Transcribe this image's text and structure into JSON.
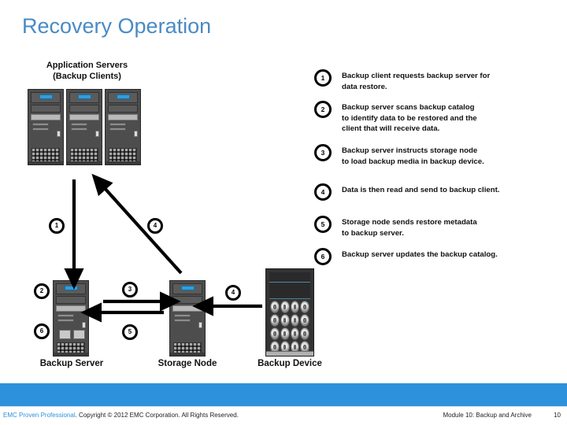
{
  "slide": {
    "title": "Recovery Operation",
    "title_color": "#4a8ac4",
    "accent_color": "#2e91dc",
    "background": "#ffffff"
  },
  "diagram": {
    "group_heading_line1": "Application Servers",
    "group_heading_line2": "(Backup Clients)",
    "components": [
      {
        "name": "backup-server",
        "label": "Backup Server"
      },
      {
        "name": "storage-node",
        "label": "Storage Node"
      },
      {
        "name": "backup-device",
        "label": "Backup Device"
      }
    ],
    "flow_markers": [
      {
        "id": "m1",
        "number": "1"
      },
      {
        "id": "m2",
        "number": "2"
      },
      {
        "id": "m3",
        "number": "3"
      },
      {
        "id": "m4a",
        "number": "4"
      },
      {
        "id": "m4b",
        "number": "4"
      },
      {
        "id": "m5",
        "number": "5"
      },
      {
        "id": "m6",
        "number": "6"
      }
    ]
  },
  "legend": {
    "steps": [
      {
        "number": "1",
        "text": "Backup client requests backup server for\ndata restore."
      },
      {
        "number": "2",
        "text": "Backup server scans backup catalog\nto identify data to be restored and the\nclient that will receive data."
      },
      {
        "number": "3",
        "text": "Backup server instructs storage node\nto load backup media in backup device."
      },
      {
        "number": "4",
        "text": "Data is then read and send to backup client."
      },
      {
        "number": "5",
        "text": "Storage node sends restore metadata\nto backup server."
      },
      {
        "number": "6",
        "text": "Backup server updates the backup catalog."
      }
    ]
  },
  "footer": {
    "brand": "EMC Proven Professional",
    "copyright": ". Copyright © 2012 EMC Corporation. All Rights Reserved.",
    "module": "Module 10: Backup and Archive",
    "page": "10"
  }
}
